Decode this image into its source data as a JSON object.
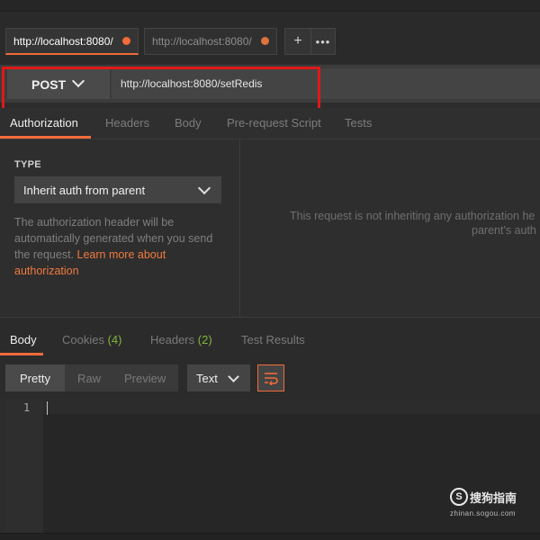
{
  "tabs": [
    {
      "label": "http://localhost:8080/"
    },
    {
      "label": "http://localhost:8080/"
    }
  ],
  "tab_actions": {
    "add": "+",
    "more": "•••"
  },
  "request": {
    "method": "POST",
    "url": "http://localhost:8080/setRedis"
  },
  "request_tabs": [
    "Authorization",
    "Headers",
    "Body",
    "Pre-request Script",
    "Tests"
  ],
  "auth": {
    "type_label": "TYPE",
    "type_value": "Inherit auth from parent",
    "description": "The authorization header will be automatically generated when you send the request. ",
    "link_text": "Learn more about authorization",
    "right_message_line1": "This request is not inheriting any authorization he",
    "right_message_line2": "parent's auth"
  },
  "response_tabs": {
    "body": "Body",
    "cookies": "Cookies",
    "cookies_count": "(4)",
    "headers": "Headers",
    "headers_count": "(2)",
    "test_results": "Test Results"
  },
  "view_modes": [
    "Pretty",
    "Raw",
    "Preview"
  ],
  "format": "Text",
  "editor": {
    "line_number": "1"
  },
  "watermark": {
    "logo": "S",
    "text": "搜狗指南",
    "sub": "zhinan.sogou.com"
  },
  "colors": {
    "accent": "#f26b3a",
    "highlight": "#e01818",
    "count": "#7fb83a"
  }
}
